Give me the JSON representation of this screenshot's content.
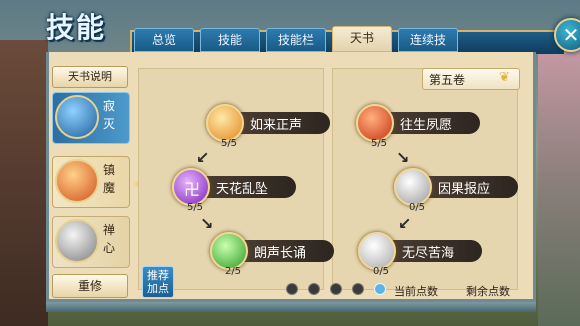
{
  "header": {
    "title": "技能",
    "tabs": [
      {
        "label": "总览",
        "active": false
      },
      {
        "label": "技能",
        "active": false
      },
      {
        "label": "技能栏",
        "active": false
      },
      {
        "label": "天书",
        "active": true
      },
      {
        "label": "连续技",
        "active": false
      }
    ],
    "close_icon": "close-icon"
  },
  "sidebar": {
    "description_button": "天书说明",
    "books": [
      {
        "label": "寂灭",
        "state": "active",
        "icon": "swirl-rune-icon",
        "color": "#3b8fd0"
      },
      {
        "label": "镇魔",
        "state": "highlighted",
        "icon": "demon-face-icon",
        "color": "#e36a2b"
      },
      {
        "label": "禅心",
        "state": "normal",
        "icon": "zen-face-icon",
        "color": "#8d8d8d"
      }
    ],
    "reset_button": "重修"
  },
  "volume": {
    "label": "第五卷",
    "icon": "ribbon-icon"
  },
  "left_page": {
    "nodes": [
      {
        "name": "如来正声",
        "count": "5/5",
        "orb_color": "#f0a33a",
        "icon": "golden-flame-icon"
      },
      {
        "name": "天花乱坠",
        "count": "5/5",
        "orb_color": "#9a3fd0",
        "icon": "swastika-icon"
      },
      {
        "name": "朗声长诵",
        "count": "2/5",
        "orb_color": "#4fc23b",
        "icon": "green-burst-icon"
      }
    ]
  },
  "right_page": {
    "nodes": [
      {
        "name": "往生夙愿",
        "count": "5/5",
        "orb_color": "#e1512a",
        "icon": "red-lotus-icon"
      },
      {
        "name": "因果报应",
        "count": "0/5",
        "orb_color": "#c8c8c8",
        "icon": "grey-swirl-icon"
      },
      {
        "name": "无尽苦海",
        "count": "0/5",
        "orb_color": "#d6d6d6",
        "icon": "grey-wave-icon"
      }
    ]
  },
  "recommend_button": "推荐\n加点",
  "pagination": {
    "dots": 5,
    "active_index": 4
  },
  "points": {
    "current_label": "当前点数",
    "remaining_label": "剩余点数"
  }
}
